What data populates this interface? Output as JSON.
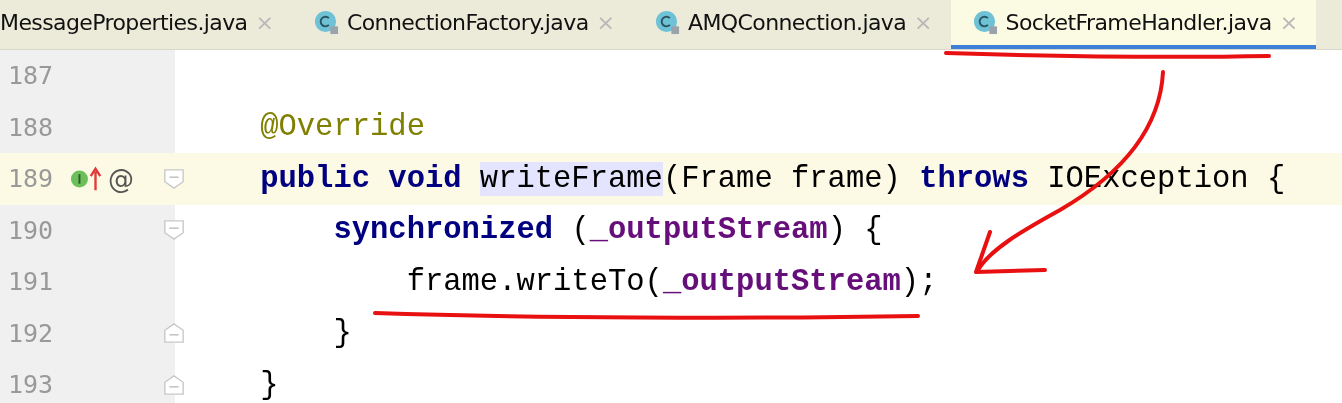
{
  "tabs": [
    {
      "label": "MessageProperties.java",
      "selected": false,
      "class_icon": false
    },
    {
      "label": "ConnectionFactory.java",
      "selected": false,
      "class_icon": true
    },
    {
      "label": "AMQConnection.java",
      "selected": false,
      "class_icon": true
    },
    {
      "label": "SocketFrameHandler.java",
      "selected": true,
      "class_icon": true
    }
  ],
  "tab_close": "×",
  "lines": [
    {
      "number": "187",
      "current": false,
      "implements": false,
      "fold_open": false,
      "fold_close": false
    },
    {
      "number": "188",
      "current": false,
      "implements": false,
      "fold_open": false,
      "fold_close": false,
      "tokens": [
        {
          "kind": "annotation",
          "text": "    @Override"
        }
      ]
    },
    {
      "number": "189",
      "current": true,
      "fold_open": true,
      "fold_close": false,
      "implements": true,
      "gutter_mark": "@",
      "tokens": [
        {
          "kind": "keyword",
          "text": "    public void "
        },
        {
          "kind": "usage",
          "text": "writeFrame"
        },
        {
          "kind": "plain",
          "text": "(Frame frame) "
        },
        {
          "kind": "keyword",
          "text": "throws "
        },
        {
          "kind": "plain",
          "text": "IOException {"
        }
      ]
    },
    {
      "number": "190",
      "current": false,
      "implements": false,
      "fold_open": true,
      "fold_close": false,
      "tokens": [
        {
          "kind": "keyword",
          "text": "        synchronized "
        },
        {
          "kind": "plain",
          "text": "("
        },
        {
          "kind": "field",
          "text": "_outputStream"
        },
        {
          "kind": "plain",
          "text": ") {"
        }
      ]
    },
    {
      "number": "191",
      "current": false,
      "implements": false,
      "fold_open": false,
      "fold_close": false,
      "tokens": [
        {
          "kind": "plain",
          "text": "            frame.writeTo("
        },
        {
          "kind": "field",
          "text": "_outputStream"
        },
        {
          "kind": "plain",
          "text": ");"
        }
      ]
    },
    {
      "number": "192",
      "current": false,
      "implements": false,
      "fold_open": false,
      "fold_close": true,
      "tokens": [
        {
          "kind": "plain",
          "text": "        }"
        }
      ]
    },
    {
      "number": "193",
      "current": false,
      "implements": false,
      "fold_open": false,
      "fold_close": true,
      "tokens": [
        {
          "kind": "plain",
          "text": "    }"
        }
      ]
    }
  ]
}
